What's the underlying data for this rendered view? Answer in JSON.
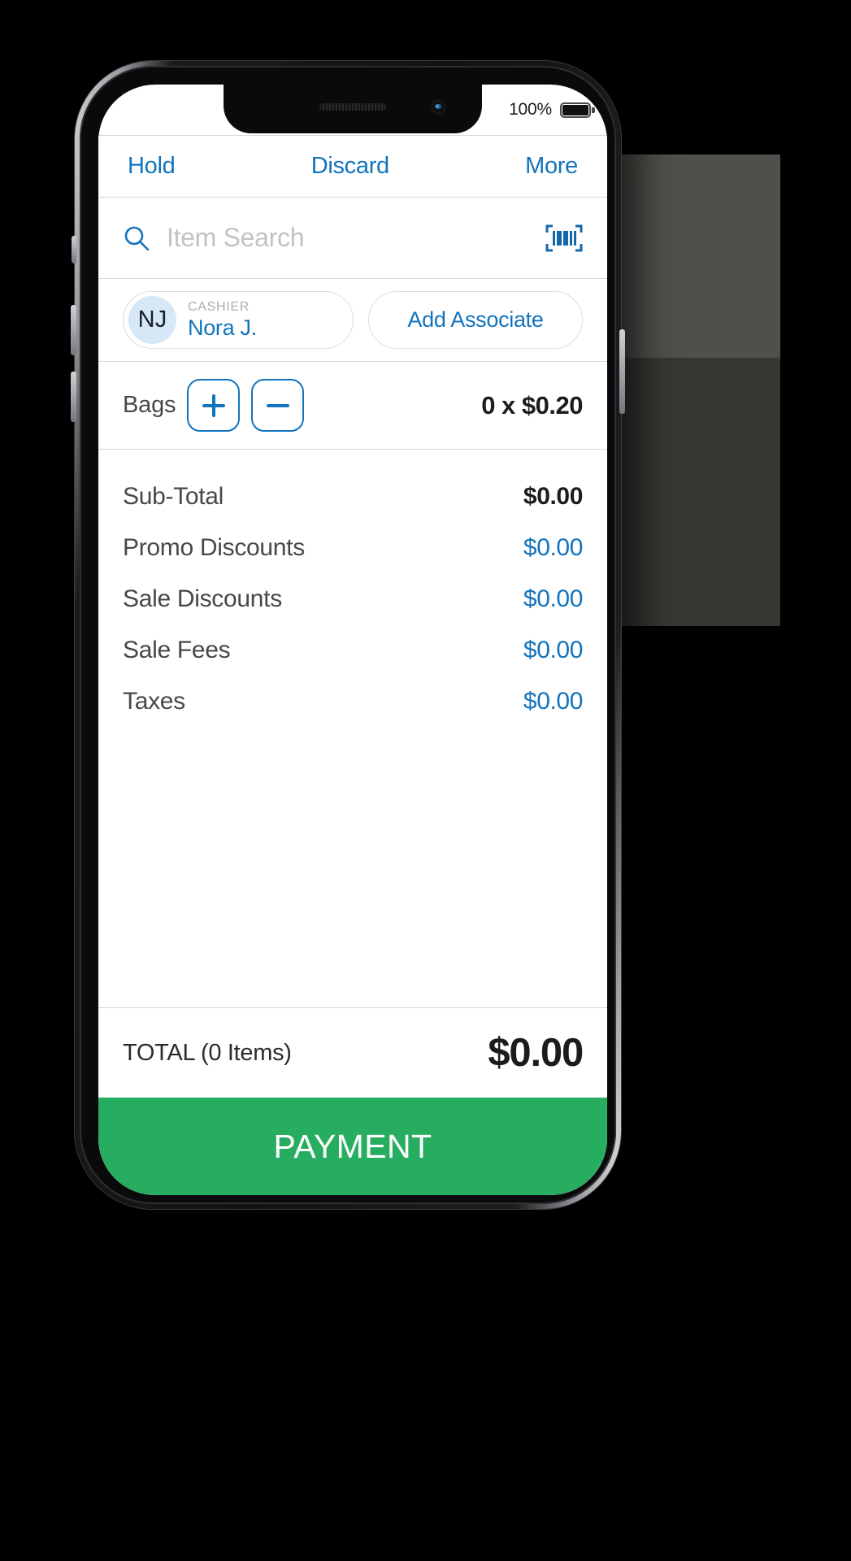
{
  "status_bar": {
    "battery_percent": "100%",
    "battery_icon": "battery-full-icon"
  },
  "navbar": {
    "hold_label": "Hold",
    "discard_label": "Discard",
    "more_label": "More"
  },
  "search": {
    "placeholder": "Item Search",
    "value": "",
    "search_icon": "search-icon",
    "barcode_icon": "barcode-scan-icon"
  },
  "associates": {
    "cashier_initials": "NJ",
    "cashier_kicker": "CASHIER",
    "cashier_name": "Nora J.",
    "add_associate_label": "Add Associate"
  },
  "bags": {
    "label": "Bags",
    "increment_label": "+",
    "decrement_label": "−",
    "value": "0 x $0.20"
  },
  "totals": {
    "rows": [
      {
        "label": "Sub-Total",
        "value": "$0.00",
        "emphasis": true
      },
      {
        "label": "Promo Discounts",
        "value": "$0.00",
        "emphasis": false
      },
      {
        "label": "Sale Discounts",
        "value": "$0.00",
        "emphasis": false
      },
      {
        "label": "Sale Fees",
        "value": "$0.00",
        "emphasis": false
      },
      {
        "label": "Taxes",
        "value": "$0.00",
        "emphasis": false
      }
    ]
  },
  "grand_total": {
    "label": "TOTAL (0 Items)",
    "value": "$0.00"
  },
  "payment": {
    "label": "PAYMENT",
    "color": "#27ad60"
  },
  "colors": {
    "accent_blue": "#1274bd",
    "green": "#27ad60",
    "text_dark": "#1c1c1e",
    "text_gray": "#48484a",
    "placeholder_gray": "#c3c3c5",
    "avatar_bg": "#d6e7f7",
    "hairline": "#d6d6d8"
  }
}
